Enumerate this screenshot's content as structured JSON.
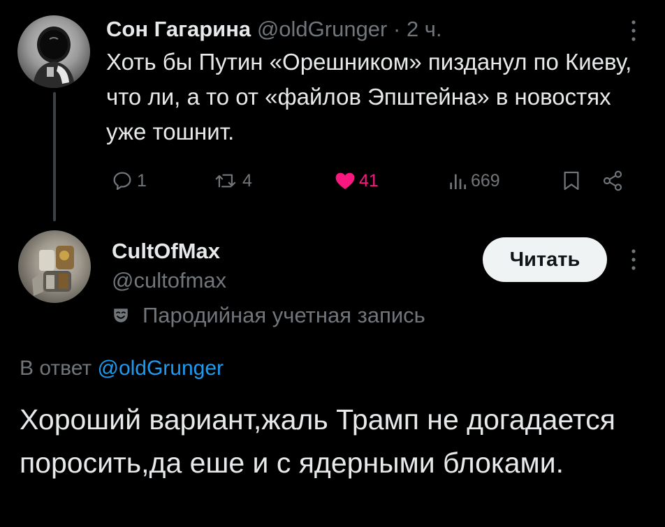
{
  "colors": {
    "background": "#000000",
    "text_primary": "#e7e9ea",
    "text_secondary": "#71767b",
    "like": "#f91880",
    "link": "#1d9bf0",
    "follow_button_bg": "#eff3f4",
    "thread_line": "#3e4144"
  },
  "tweet1": {
    "author_name": "Сон Гагарина",
    "handle": "@oldGrunger",
    "separator": "·",
    "time": "2 ч.",
    "more_icon": "more-vertical-icon",
    "text": "Хоть бы Путин «Орешником» пизданул по Киеву, что ли, а то от «файлов Эпштейна» в новостях уже тошнит.",
    "actions": {
      "reply": {
        "icon": "reply-icon",
        "count": "1"
      },
      "retweet": {
        "icon": "retweet-icon",
        "count": "4"
      },
      "like": {
        "icon": "heart-icon",
        "count": "41",
        "liked": true
      },
      "views": {
        "icon": "views-icon",
        "count": "669"
      },
      "bookmark": {
        "icon": "bookmark-icon"
      },
      "share": {
        "icon": "share-icon"
      }
    }
  },
  "tweet2": {
    "author_name": "CultOfMax",
    "handle": "@cultofmax",
    "parody_label": "Пародийная учетная запись",
    "parody_icon": "parody-mask-icon",
    "follow_label": "Читать",
    "more_icon": "more-vertical-icon",
    "reply_to_prefix": "В ответ",
    "reply_to_handle": "@oldGrunger",
    "text": "Хороший вариант,жаль Трамп не догадается поросить,да еше и с ядерными блоками."
  }
}
